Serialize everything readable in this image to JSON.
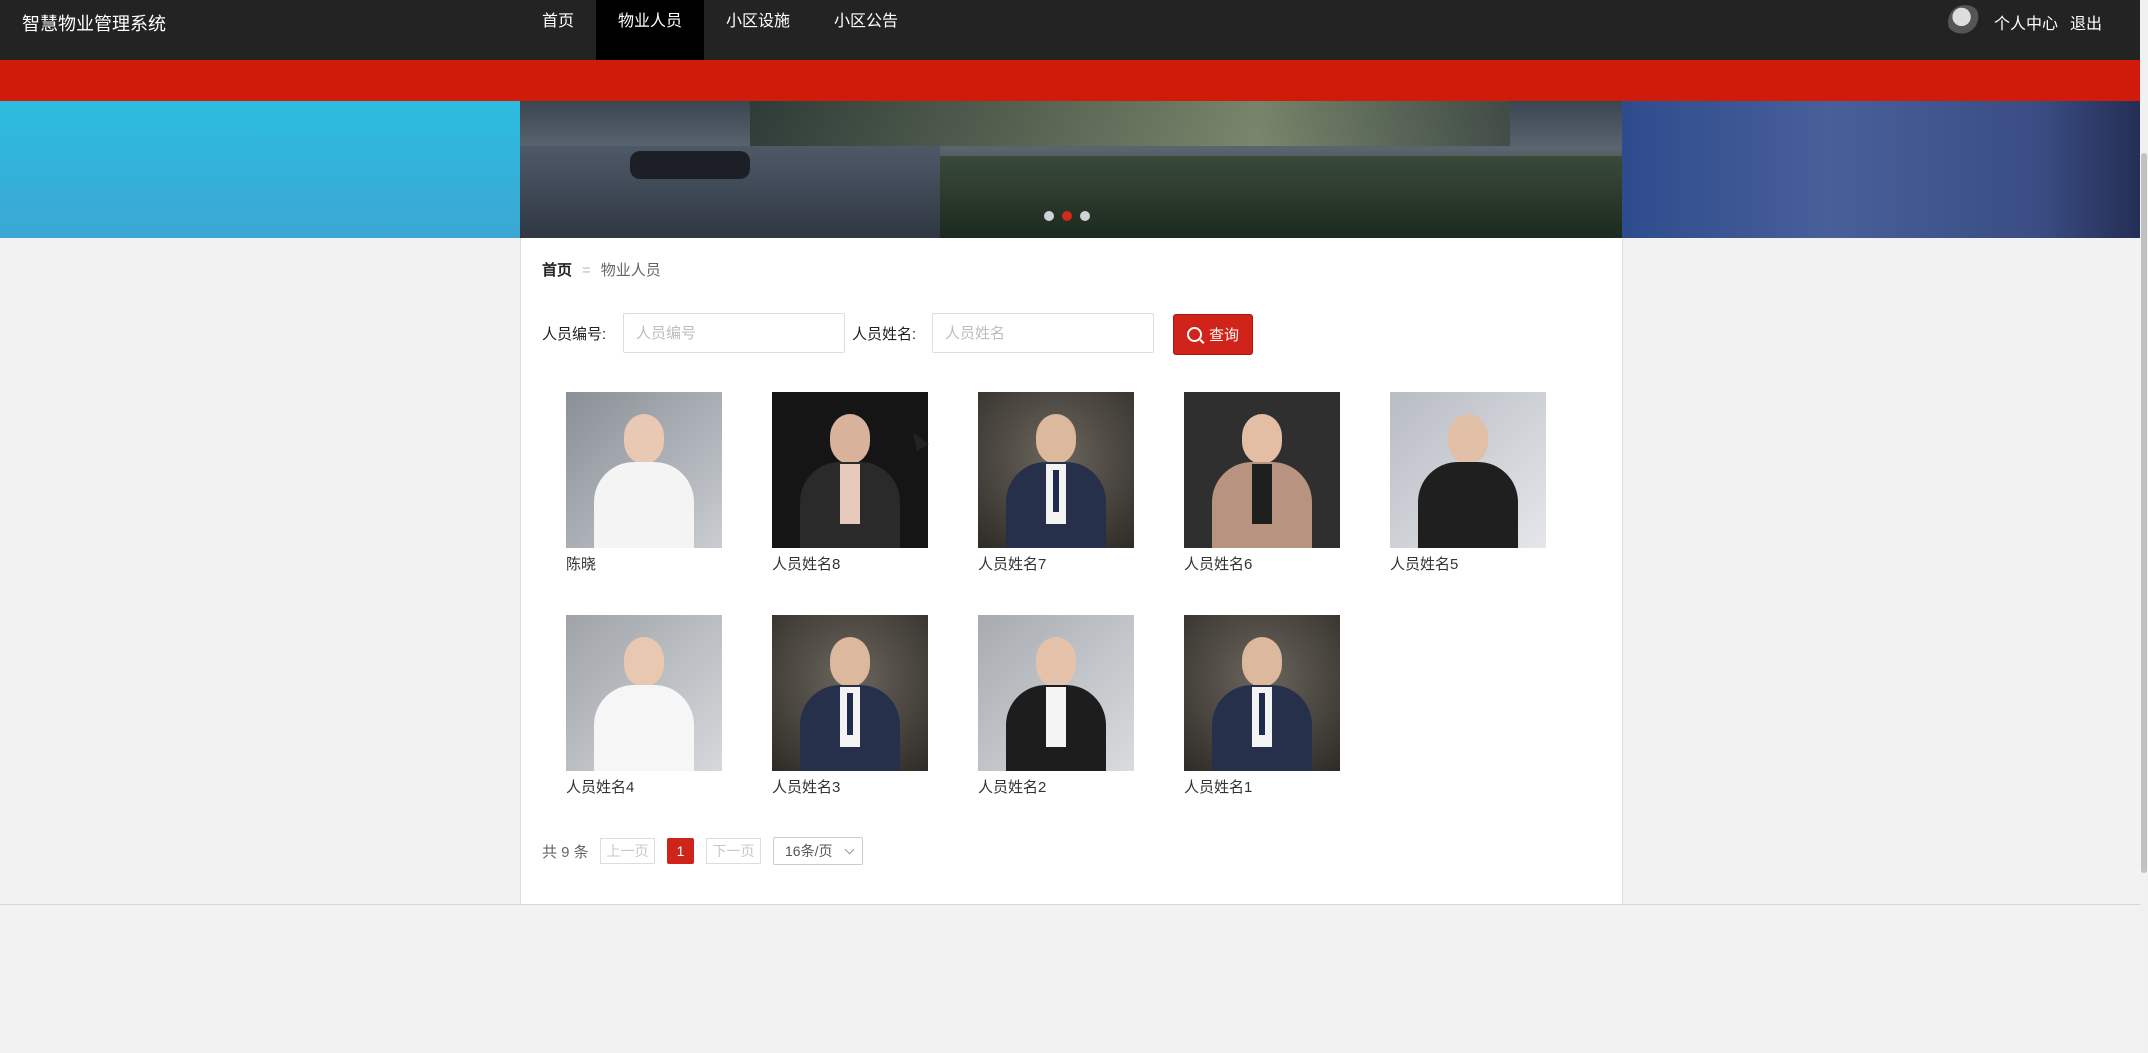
{
  "app": {
    "title": "智慧物业管理系统"
  },
  "nav": {
    "items": [
      {
        "label": "首页"
      },
      {
        "label": "物业人员"
      },
      {
        "label": "小区设施"
      },
      {
        "label": "小区公告"
      }
    ],
    "active": "物业人员",
    "user_center": "个人中心",
    "logout": "退出"
  },
  "carousel": {
    "slides": 3,
    "active_index": 1
  },
  "breadcrumb": {
    "home": "首页",
    "separator": "=",
    "current": "物业人员"
  },
  "search": {
    "staff_id_label": "人员编号:",
    "staff_id_placeholder": "人员编号",
    "staff_id_value": "",
    "staff_name_label": "人员姓名:",
    "staff_name_placeholder": "人员姓名",
    "staff_name_value": "",
    "query_button": "查询"
  },
  "staff": [
    {
      "name": "陈晓"
    },
    {
      "name": "人员姓名8"
    },
    {
      "name": "人员姓名7"
    },
    {
      "name": "人员姓名6"
    },
    {
      "name": "人员姓名5"
    },
    {
      "name": "人员姓名4"
    },
    {
      "name": "人员姓名3"
    },
    {
      "name": "人员姓名2"
    },
    {
      "name": "人员姓名1"
    }
  ],
  "pagination": {
    "total_text": "共 9 条",
    "prev": "上一页",
    "current_page": "1",
    "next": "下一页",
    "page_size": "16条/页"
  },
  "colors": {
    "accent": "#d0231a",
    "nav_bg": "#232323",
    "red_bar": "#d01a0a"
  }
}
